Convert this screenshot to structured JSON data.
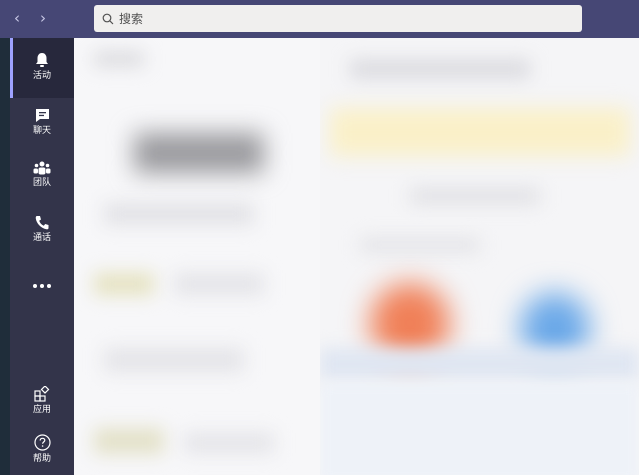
{
  "search": {
    "placeholder": "搜索"
  },
  "nav": {
    "back": "‹",
    "forward": "›"
  },
  "sidebar": {
    "items": [
      {
        "label": "活动",
        "icon": "bell-icon"
      },
      {
        "label": "聊天",
        "icon": "chat-icon"
      },
      {
        "label": "团队",
        "icon": "teams-icon"
      },
      {
        "label": "通话",
        "icon": "phone-icon"
      }
    ],
    "more_icon": "more-icon",
    "bottom": [
      {
        "label": "应用",
        "icon": "apps-icon"
      },
      {
        "label": "帮助",
        "icon": "help-icon"
      }
    ]
  },
  "colors": {
    "titlebar": "#464775",
    "sidebar": "#33344a",
    "accent": "#9ea2ff"
  }
}
